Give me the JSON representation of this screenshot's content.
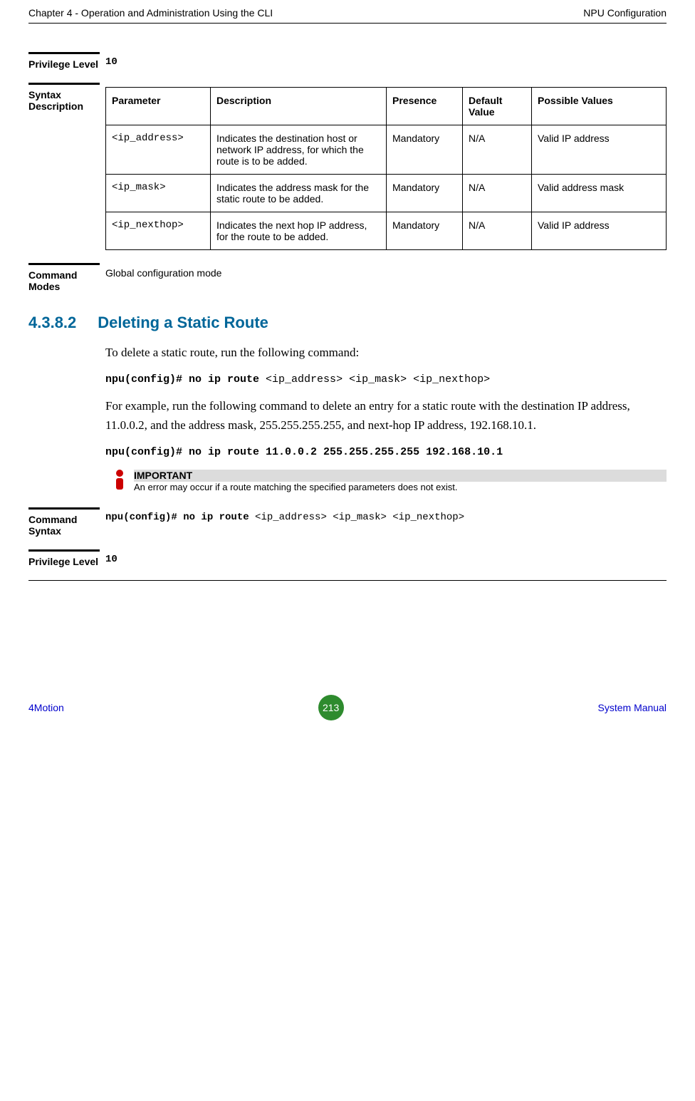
{
  "header": {
    "left": "Chapter 4 - Operation and Administration Using the CLI",
    "right": "NPU Configuration"
  },
  "priv1": {
    "label": "Privilege Level",
    "value": "10"
  },
  "syntax": {
    "label": "Syntax Description",
    "headers": {
      "param": "Parameter",
      "desc": "Description",
      "presence": "Presence",
      "def": "Default Value",
      "possible": "Possible Values"
    },
    "rows": [
      {
        "param": "<ip_address>",
        "desc": "Indicates the destination host or network IP address, for which the route is to be added.",
        "presence": "Mandatory",
        "def": "N/A",
        "possible": "Valid IP address"
      },
      {
        "param": "<ip_mask>",
        "desc": "Indicates the address mask for the static route to be added.",
        "presence": "Mandatory",
        "def": "N/A",
        "possible": "Valid address mask"
      },
      {
        "param": "<ip_nexthop>",
        "desc": "Indicates the next hop IP address, for the route to be added.",
        "presence": "Mandatory",
        "def": "N/A",
        "possible": "Valid IP address"
      }
    ]
  },
  "cmdmodes": {
    "label": "Command Modes",
    "value": "Global configuration mode"
  },
  "section": {
    "num": "4.3.8.2",
    "title": "Deleting a Static Route"
  },
  "body": {
    "p1": "To delete a static route, run the following command:",
    "cmd1_b": "npu(config)# no ip route ",
    "cmd1_r": "<ip_address> <ip_mask> <ip_nexthop>",
    "p2": "For example, run the following command to delete an entry for a static route with the destination IP address, 11.0.0.2, and the address mask, 255.255.255.255, and next-hop IP address, 192.168.10.1.",
    "cmd2": "npu(config)# no ip route 11.0.0.2 255.255.255.255 192.168.10.1"
  },
  "important": {
    "title": "IMPORTANT",
    "text": "An error may occur if a route matching the specified parameters does not exist."
  },
  "cmdsyntax": {
    "label": "Command Syntax",
    "b": "npu(config)# no ip route ",
    "r": "<ip_address> <ip_mask> <ip_nexthop>"
  },
  "priv2": {
    "label": "Privilege Level",
    "value": "10"
  },
  "footer": {
    "left": "4Motion",
    "page": "213",
    "right": "System Manual"
  }
}
